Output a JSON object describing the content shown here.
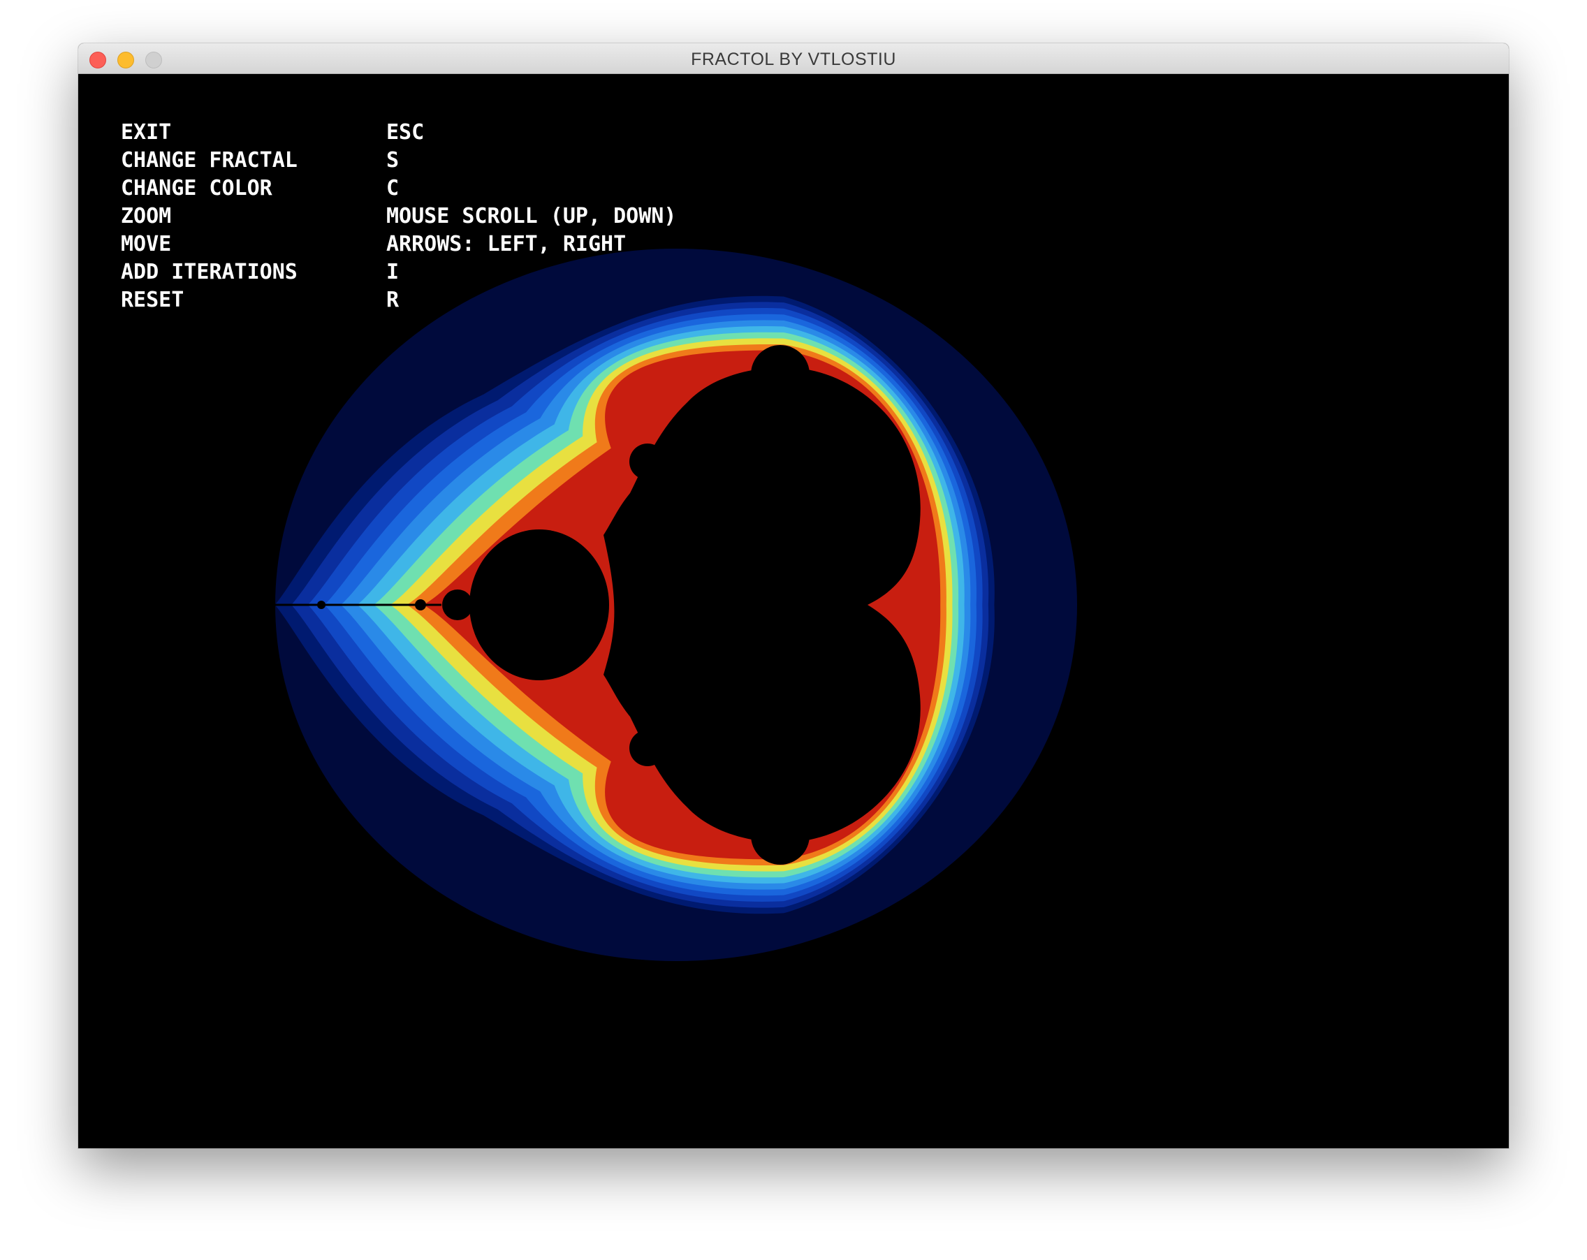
{
  "window": {
    "title": "FRACTOL BY VTLOSTIU"
  },
  "help": {
    "rows": [
      {
        "action": "EXIT",
        "key": "ESC"
      },
      {
        "action": "CHANGE FRACTAL",
        "key": "S"
      },
      {
        "action": "CHANGE COLOR",
        "key": "C"
      },
      {
        "action": "ZOOM",
        "key": "MOUSE SCROLL (UP, DOWN)"
      },
      {
        "action": "MOVE",
        "key": "ARROWS: LEFT, RIGHT"
      },
      {
        "action": "ADD ITERATIONS",
        "key": "I"
      },
      {
        "action": "RESET",
        "key": "R"
      }
    ]
  },
  "colors": {
    "background": "#000000",
    "set_interior": "#000000",
    "palette": [
      "#000a3c",
      "#001a70",
      "#0a2e9e",
      "#1148c4",
      "#1a66dd",
      "#2a8ae8",
      "#3fb6e8",
      "#6fe0b0",
      "#e8e040",
      "#f07a1a",
      "#c81e10"
    ]
  }
}
